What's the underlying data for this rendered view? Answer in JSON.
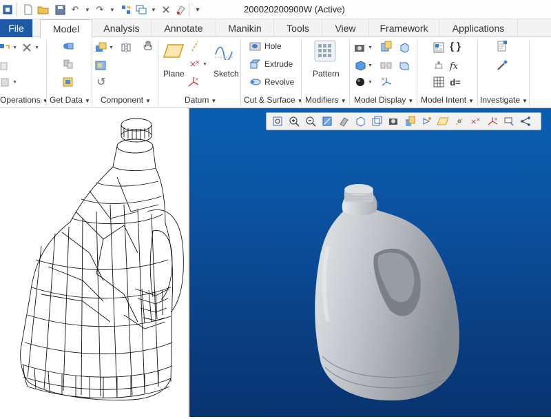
{
  "window": {
    "title": "200020200900W (Active)"
  },
  "quick_access": {
    "icons": [
      "app-icon",
      "new-icon",
      "open-icon",
      "save-icon",
      "undo-icon",
      "redo-icon",
      "regenerate-icon",
      "windows-icon",
      "close-window-icon",
      "paint-icon",
      "customize-icon"
    ]
  },
  "tabs": [
    {
      "label": "File"
    },
    {
      "label": "Model"
    },
    {
      "label": "Analysis"
    },
    {
      "label": "Annotate"
    },
    {
      "label": "Manikin"
    },
    {
      "label": "Tools"
    },
    {
      "label": "View"
    },
    {
      "label": "Framework"
    },
    {
      "label": "Applications"
    }
  ],
  "ribbon": {
    "groups": [
      {
        "label": "Operations"
      },
      {
        "label": "Get Data"
      },
      {
        "label": "Component"
      },
      {
        "label": "Datum"
      },
      {
        "label": "Cut & Surface"
      },
      {
        "label": "Modifiers"
      },
      {
        "label": "Model Display"
      },
      {
        "label": "Model Intent"
      },
      {
        "label": "Investigate"
      }
    ],
    "datum": {
      "plane_label": "Plane",
      "sketch_label": "Sketch"
    },
    "cut_surface": {
      "hole_label": "Hole",
      "extrude_label": "Extrude",
      "revolve_label": "Revolve"
    },
    "modifiers": {
      "pattern_label": "Pattern"
    },
    "model_intent": {
      "relations_symbol": "d=",
      "param_symbol": "{ }"
    }
  },
  "colors": {
    "file_tab": "#1f5aa6",
    "viewport_top": "#0a5fb2",
    "viewport_bottom": "#083470",
    "model_gray": "#b8bcc2"
  }
}
